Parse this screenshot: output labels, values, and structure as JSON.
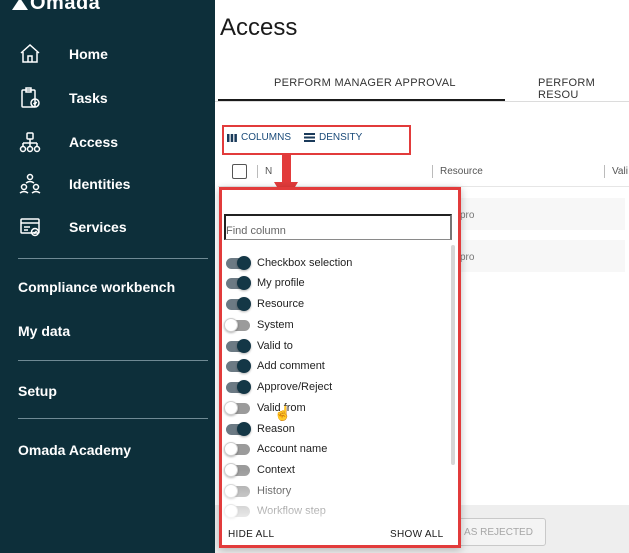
{
  "app": {
    "logo": "Omada"
  },
  "sidebar": {
    "items": [
      {
        "label": "Home",
        "icon": "home-icon"
      },
      {
        "label": "Tasks",
        "icon": "clipboard-icon"
      },
      {
        "label": "Access",
        "icon": "access-tree-icon"
      },
      {
        "label": "Identities",
        "icon": "people-icon"
      },
      {
        "label": "Services",
        "icon": "services-icon"
      }
    ],
    "compliance": "Compliance workbench",
    "mydata": "My data",
    "setup": "Setup",
    "academy": "Omada Academy"
  },
  "page": {
    "title": "Access"
  },
  "tabs": [
    {
      "label": "PERFORM MANAGER APPROVAL",
      "active": true
    },
    {
      "label": "PERFORM RESOU",
      "active": false
    }
  ],
  "toolbar": {
    "columns": "COLUMNS",
    "density": "DENSITY"
  },
  "table": {
    "headers": {
      "col1": "N",
      "resource": "Resource",
      "valid": "Vali"
    },
    "row_fragments": [
      "pro",
      "pro"
    ]
  },
  "panel": {
    "find_placeholder": "Find column",
    "columns": [
      {
        "label": "Checkbox selection",
        "enabled": true
      },
      {
        "label": "My profile",
        "enabled": true
      },
      {
        "label": "Resource",
        "enabled": true
      },
      {
        "label": "System",
        "enabled": false
      },
      {
        "label": "Valid to",
        "enabled": true
      },
      {
        "label": "Add comment",
        "enabled": true
      },
      {
        "label": "Approve/Reject",
        "enabled": true
      },
      {
        "label": "Valid from",
        "enabled": false
      },
      {
        "label": "Reason",
        "enabled": true
      },
      {
        "label": "Account name",
        "enabled": false
      },
      {
        "label": "Context",
        "enabled": false
      },
      {
        "label": "History",
        "enabled": false
      },
      {
        "label": "Workflow step",
        "enabled": false
      }
    ],
    "hide_all": "HIDE ALL",
    "show_all": "SHOW ALL"
  },
  "footer": {
    "reject_button": "AS REJECTED"
  },
  "colors": {
    "sidebar_bg": "#0d2f3a",
    "highlight": "#e23b3b",
    "toggle_on": "#143746"
  }
}
